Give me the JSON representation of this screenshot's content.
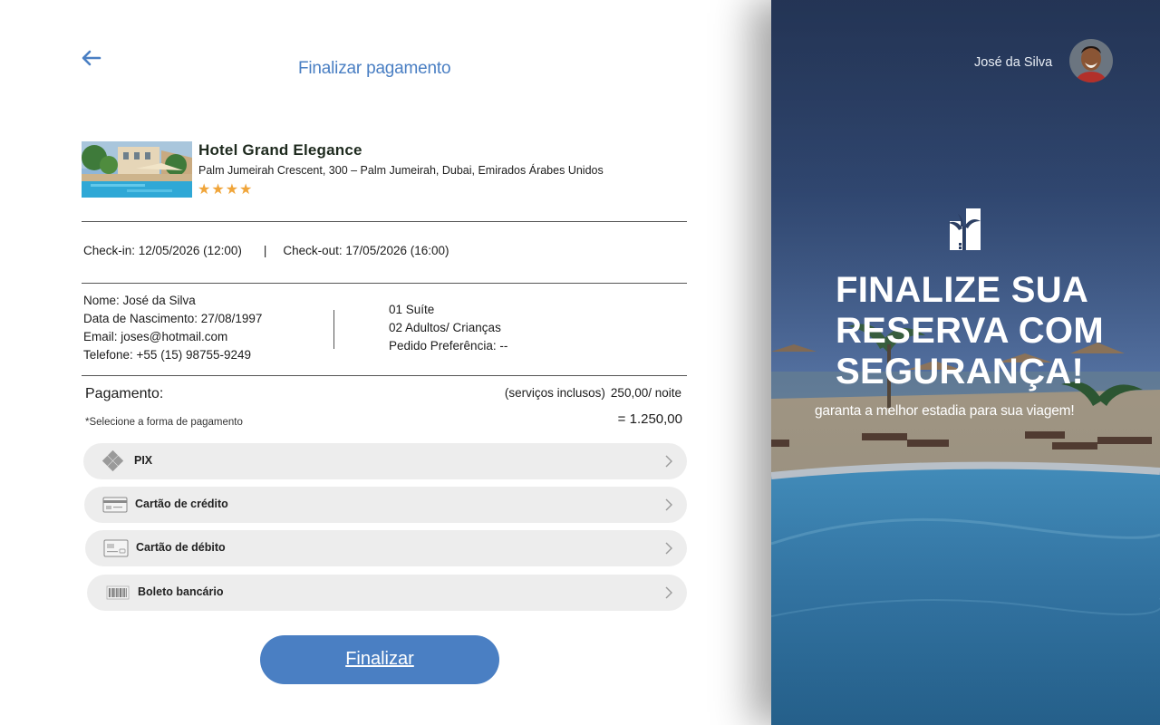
{
  "header": {
    "title": "Finalizar pagamento"
  },
  "hotel": {
    "name": "Hotel Grand Elegance",
    "address": "Palm Jumeirah Crescent, 300 – Palm Jumeirah, Dubai, Emirados Árabes Unidos",
    "stars": "★★★★",
    "rating": 4
  },
  "stay": {
    "checkin": "Check-in: 12/05/2026 (12:00)",
    "separator": "|",
    "checkout": "Check-out: 17/05/2026 (16:00)"
  },
  "guest": {
    "name": "Nome: José da Silva",
    "birth": "Data de Nascimento: 27/08/1997",
    "email": "Email: joses@hotmail.com",
    "phone": "Telefone: +55 (15) 98755-9249"
  },
  "room": {
    "suite": "01 Suíte",
    "people": "02 Adultos/ Crianças",
    "preference": "Pedido Preferência: --"
  },
  "payment": {
    "title": "Pagamento:",
    "note": "*Selecione a forma de pagamento",
    "included": "(serviços inclusos)",
    "rate": "250,00/ noite",
    "total": "= 1.250,00",
    "methods": [
      {
        "label": "PIX",
        "icon": "pix-icon"
      },
      {
        "label": "Cartão de crédito",
        "icon": "credit-card-icon"
      },
      {
        "label": "Cartão de débito",
        "icon": "debit-card-icon"
      },
      {
        "label": "Boleto bancário",
        "icon": "barcode-icon"
      }
    ]
  },
  "actions": {
    "finish": "Finalizar"
  },
  "promo": {
    "user_name": "José da Silva",
    "headline_1": "FINALIZE SUA",
    "headline_2": "RESERVA COM",
    "headline_3": "SEGURANÇA!",
    "subline": "garanta a melhor estadia para sua viagem!"
  },
  "colors": {
    "accent": "#4a7fc3",
    "stars": "#f0a53a",
    "method_bg": "#ededed"
  }
}
